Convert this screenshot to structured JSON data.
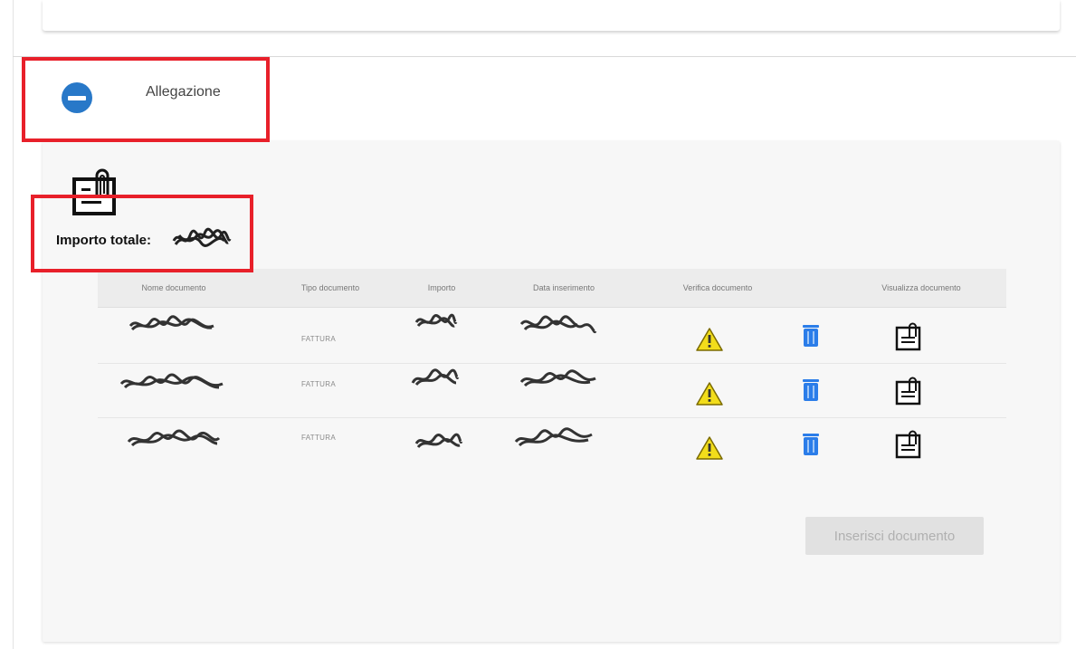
{
  "section": {
    "title": "Allegazione"
  },
  "summary": {
    "total_label": "Importo totale:"
  },
  "table": {
    "headers": [
      "Nome documento",
      "Tipo documento",
      "Importo",
      "Data inserimento",
      "Verifica documento",
      "Visualizza documento"
    ],
    "rows": [
      {
        "type": "FATTURA"
      },
      {
        "type": "FATTURA"
      },
      {
        "type": "FATTURA"
      }
    ]
  },
  "actions": {
    "insert_label": "Inserisci documento"
  },
  "colors": {
    "accent": "#2878c8",
    "highlight": "#e8202a",
    "warning": "#f2dd1b",
    "trash": "#2b7de9"
  }
}
